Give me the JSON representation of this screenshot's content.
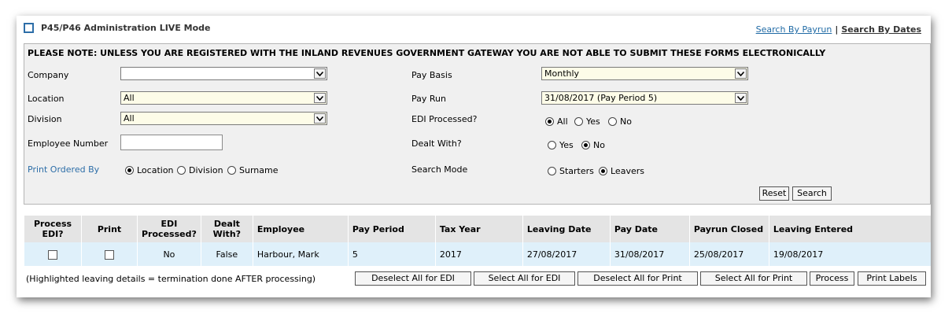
{
  "header": {
    "title": "P45/P46 Administration LIVE Mode",
    "search_by_payrun": "Search By Payrun",
    "separator": "|",
    "search_by_dates": "Search By Dates"
  },
  "notice": "PLEASE NOTE: UNLESS YOU ARE REGISTERED WITH THE INLAND REVENUES GOVERNMENT GATEWAY YOU ARE NOT ABLE TO SUBMIT THESE FORMS ELECTRONICALLY",
  "filters": {
    "company": {
      "label": "Company",
      "value": ""
    },
    "location": {
      "label": "Location",
      "value": "All"
    },
    "division": {
      "label": "Division",
      "value": "All"
    },
    "employee_number": {
      "label": "Employee Number",
      "value": ""
    },
    "print_ordered_by": {
      "label": "Print Ordered By",
      "options": [
        "Location",
        "Division",
        "Surname"
      ],
      "selected": "Location"
    },
    "pay_basis": {
      "label": "Pay Basis",
      "value": "Monthly"
    },
    "pay_run": {
      "label": "Pay Run",
      "value": "31/08/2017 (Pay Period 5)"
    },
    "edi_processed": {
      "label": "EDI Processed?",
      "options": [
        "All",
        "Yes",
        "No"
      ],
      "selected": "All"
    },
    "dealt_with": {
      "label": "Dealt With?",
      "options": [
        "Yes",
        "No"
      ],
      "selected": "No"
    },
    "search_mode": {
      "label": "Search Mode",
      "options": [
        "Starters",
        "Leavers"
      ],
      "selected": "Leavers"
    }
  },
  "actions": {
    "reset": "Reset",
    "search": "Search"
  },
  "table": {
    "headers": {
      "process_edi_1": "Process",
      "process_edi_2": "EDI?",
      "print": "Print",
      "edi_processed_1": "EDI",
      "edi_processed_2": "Processed?",
      "dealt_with_1": "Dealt",
      "dealt_with_2": "With?",
      "employee": "Employee",
      "pay_period": "Pay Period",
      "tax_year": "Tax Year",
      "leaving_date": "Leaving Date",
      "pay_date": "Pay Date",
      "payrun_closed": "Payrun Closed",
      "leaving_entered": "Leaving Entered"
    },
    "rows": [
      {
        "process_edi": false,
        "print": false,
        "edi_processed": "No",
        "dealt_with": "False",
        "employee": "Harbour, Mark",
        "pay_period": "5",
        "tax_year": "2017",
        "leaving_date": "27/08/2017",
        "pay_date": "31/08/2017",
        "payrun_closed": "25/08/2017",
        "leaving_entered": "19/08/2017"
      }
    ]
  },
  "footer": {
    "note": "(Highlighted leaving details = termination done AFTER processing)",
    "deselect_all_edi": "Deselect All for EDI",
    "select_all_edi": "Select All for EDI",
    "deselect_all_print": "Deselect All for Print",
    "select_all_print": "Select All for Print",
    "process": "Process",
    "print_labels": "Print Labels"
  },
  "colors": {
    "link": "#1f6aa5",
    "row_highlight": "#dff0fa",
    "header_bg": "#e4e4e4",
    "filter_bg": "#f0f0f0"
  }
}
